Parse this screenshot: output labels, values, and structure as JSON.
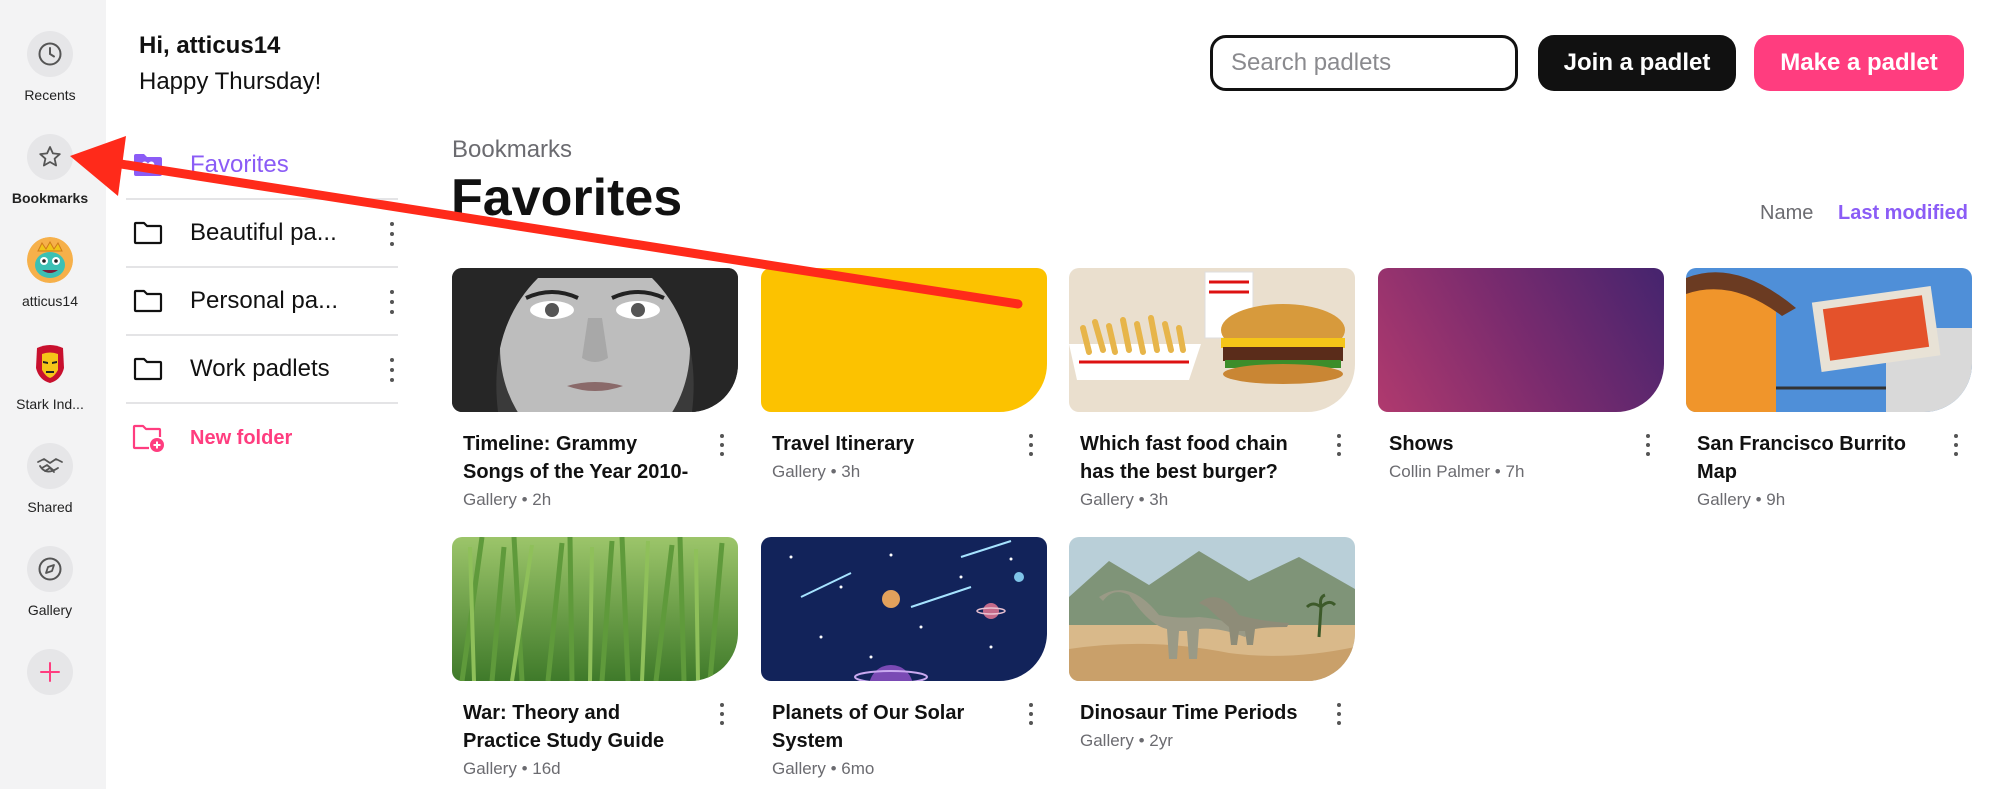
{
  "rail": {
    "items": [
      {
        "label": "Recents",
        "icon": "clock-icon"
      },
      {
        "label": "Bookmarks",
        "icon": "star-icon"
      },
      {
        "label": "atticus14",
        "icon": "monster-avatar"
      },
      {
        "label": "Stark Ind...",
        "icon": "iron-man-avatar"
      },
      {
        "label": "Shared",
        "icon": "handshake-icon"
      },
      {
        "label": "Gallery",
        "icon": "compass-icon"
      }
    ],
    "add_icon": "plus-icon"
  },
  "header": {
    "greeting_name": "Hi, atticus14",
    "greeting_day": "Happy Thursday!",
    "search_placeholder": "Search padlets",
    "join_label": "Join a padlet",
    "make_label": "Make a padlet"
  },
  "folders": [
    {
      "label": "Favorites",
      "active": true
    },
    {
      "label": "Beautiful pa..."
    },
    {
      "label": "Personal pa..."
    },
    {
      "label": "Work padlets"
    }
  ],
  "new_folder_label": "New folder",
  "main": {
    "breadcrumb": "Bookmarks",
    "title": "Favorites",
    "sort_name": "Name",
    "sort_modified": "Last modified"
  },
  "cards": [
    {
      "title": "Timeline: Grammy Songs of the Year 2010-",
      "meta": "Gallery • 2h"
    },
    {
      "title": "Travel Itinerary",
      "meta": "Gallery • 3h"
    },
    {
      "title": "Which fast food chain has the best burger?",
      "meta": "Gallery • 3h"
    },
    {
      "title": "Shows",
      "meta": "Collin Palmer • 7h"
    },
    {
      "title": "San Francisco Burrito Map",
      "meta": "Gallery • 9h"
    },
    {
      "title": "War: Theory and Practice Study Guide",
      "meta": "Gallery • 16d"
    },
    {
      "title": "Planets of Our Solar System",
      "meta": "Gallery • 6mo"
    },
    {
      "title": "Dinosaur Time Periods",
      "meta": "Gallery • 2yr"
    }
  ],
  "colors": {
    "accent_purple": "#8b5cf6",
    "accent_pink": "#ff3d7f",
    "annotation_red": "#ff2a1a",
    "travel_yellow": "#fcc200"
  }
}
